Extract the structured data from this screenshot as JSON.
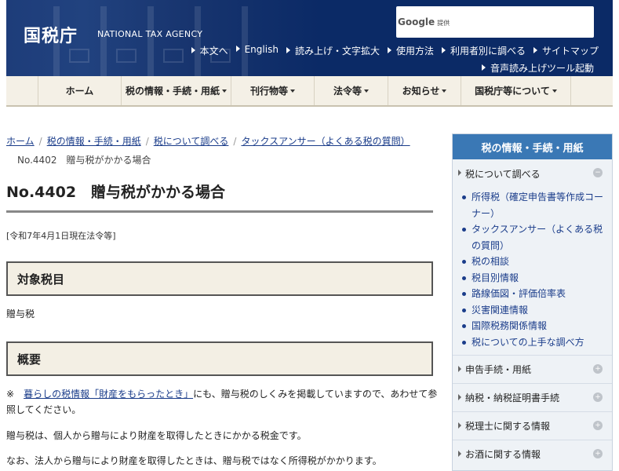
{
  "header": {
    "logo_text": "国税庁",
    "logo_en": "NATIONAL TAX AGENCY",
    "search_brand": "Google",
    "search_brand_sub": "提供",
    "search_placeholder": "",
    "utility_links": [
      "本文へ",
      "English",
      "読み上げ・文字拡大",
      "使用方法",
      "利用者別に調べる",
      "サイトマップ"
    ],
    "utility_link2": "音声読み上げツール起動"
  },
  "nav": {
    "items": [
      {
        "label": "ホーム",
        "dropdown": false
      },
      {
        "label": "税の情報・手続・用紙",
        "dropdown": true
      },
      {
        "label": "刊行物等",
        "dropdown": true
      },
      {
        "label": "法令等",
        "dropdown": true
      },
      {
        "label": "お知らせ",
        "dropdown": true
      },
      {
        "label": "国税庁等について",
        "dropdown": true
      }
    ]
  },
  "breadcrumb": {
    "links": [
      "ホーム",
      "税の情報・手続・用紙",
      "税について調べる",
      "タックスアンサー（よくある税の質問）"
    ],
    "current": "No.4402　贈与税がかかる場合"
  },
  "main": {
    "title": "No.4402　贈与税がかかる場合",
    "as_of": "[令和7年4月1日現在法令等]",
    "section1_heading": "対象税目",
    "section1_text": "贈与税",
    "section2_heading": "概要",
    "note_prefix": "※　",
    "note_link": "暮らしの税情報「財産をもらったとき」",
    "note_rest": "にも、贈与税のしくみを掲載していますので、あわせて参照してください。",
    "para1": "贈与税は、個人から贈与により財産を取得したときにかかる税金です。",
    "para2": "なお、法人から贈与により財産を取得したときは、贈与税ではなく所得税がかかります。"
  },
  "sidebar": {
    "heading": "税の情報・手続・用紙",
    "section_open": "税について調べる",
    "open_items": [
      "所得税（確定申告書等作成コーナー）",
      "タックスアンサー（よくある税の質問）",
      "税の相談",
      "税目別情報",
      "路線価図・評価倍率表",
      "災害関連情報",
      "国際税務関係情報",
      "税についての上手な調べ方"
    ],
    "sections": [
      "申告手続・用紙",
      "納税・納税証明書手続",
      "税理士に関する情報",
      "お酒に関する情報"
    ],
    "expand_symbol": "−",
    "collapse_symbol": "+"
  },
  "colors": {
    "header_blue": "#0b2a66",
    "nav_bg": "#f4f0e6",
    "sidebar_head": "#3a78b5",
    "link": "#1a3c8a"
  }
}
